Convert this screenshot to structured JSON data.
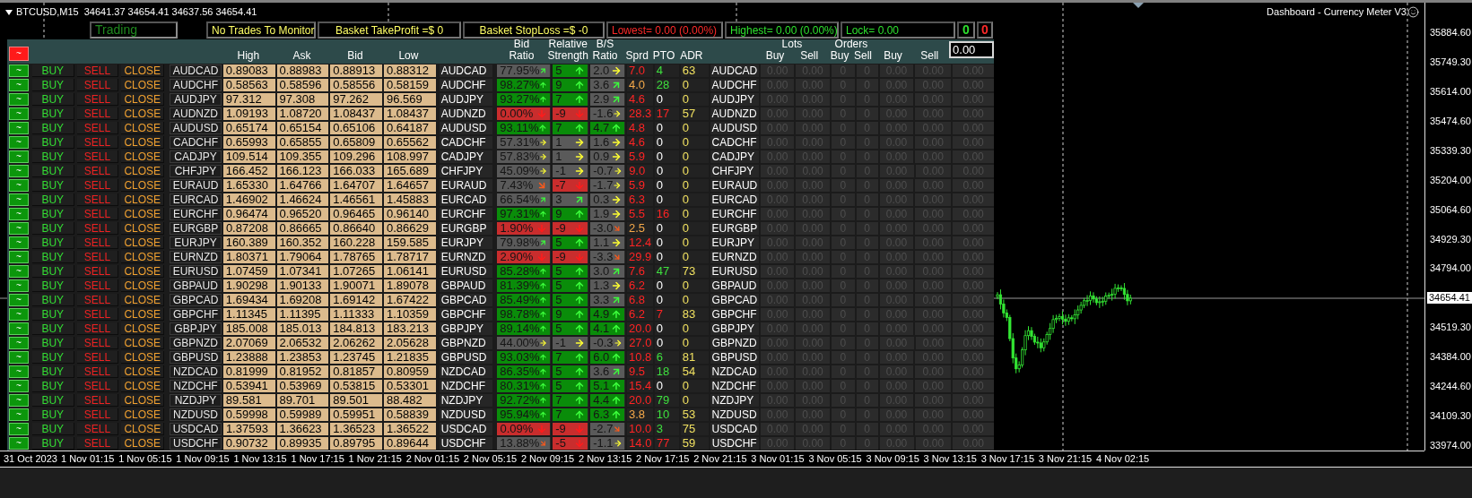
{
  "title": {
    "symbol": "BTCUSD,M15",
    "quotes": "34641.37 34654.41 34637.56 34654.41"
  },
  "indicator": "Dashboard - Currency Meter V3",
  "status_bar": [
    {
      "text": "Trading",
      "color": "#1f8a1f"
    },
    {
      "text": "No Trades To Monitor",
      "color": "#ffff66"
    },
    {
      "text": "Basket TakeProfit =$ 0",
      "color": "#ffff66"
    },
    {
      "text": "Basket StopLoss =$ -0",
      "color": "#ffff66"
    },
    {
      "text": "Lowest= 0.00 (0.00%)",
      "color": "#ff2a2a"
    },
    {
      "text": "Highest= 0.00 (0.00%)",
      "color": "#2ee02e"
    },
    {
      "text": "Lock= 0.00",
      "color": "#2ee02e"
    },
    {
      "text": "0",
      "color": "#2ee02e"
    },
    {
      "text": "0",
      "color": "#ff2a2a"
    }
  ],
  "header": {
    "toggle": {
      "label": "~",
      "on": false
    },
    "prices": [
      "High",
      "Ask",
      "Bid",
      "Low"
    ],
    "indicators": [
      "Bid Ratio",
      "Relative Strength",
      "B/S Ratio",
      "Sprd",
      "PTO",
      "ADR"
    ],
    "lots": {
      "label": "Lots",
      "buy": "Buy",
      "sell": "Sell"
    },
    "orders": {
      "label": "Orders",
      "buy": "Buy",
      "sell": "Sell"
    },
    "other": {
      "buy": "Buy",
      "sell": "Sell"
    },
    "lot_input": "0.00"
  },
  "rows": [
    {
      "toggle": {
        "label": "~",
        "on": true
      },
      "actions": [
        "BUY",
        "SELL",
        "CLOSE"
      ],
      "symbol": "AUDCAD",
      "prices": [
        "0.89083",
        "0.88983",
        "0.88913",
        "0.88312"
      ],
      "symbol_2": "AUDCAD",
      "bid_ratio": {
        "value": "77.95%",
        "color": "#5a5a5a",
        "arrow": {
          "kind": "up-right"
        }
      },
      "strength": {
        "value": "5",
        "color": "#0a8c0a",
        "arrow": {
          "kind": "up"
        }
      },
      "bs_ratio": {
        "value": "2.0",
        "color": "#5a5a5a",
        "arrow": {
          "kind": "right"
        }
      },
      "sprd": {
        "value": "7.0",
        "color": "#ff2424"
      },
      "pto": {
        "value": "4",
        "color": "#3ee03e"
      },
      "adr": "63",
      "symbol_3": "AUDCAD",
      "positions": [
        "0.00",
        "0.00",
        "0",
        "0",
        "0.00",
        "0.00",
        "0.00"
      ]
    },
    {
      "toggle": {
        "label": "~",
        "on": true
      },
      "actions": [
        "BUY",
        "SELL",
        "CLOSE"
      ],
      "symbol": "AUDCHF",
      "prices": [
        "0.58563",
        "0.58596",
        "0.58556",
        "0.58159"
      ],
      "symbol_2": "AUDCHF",
      "bid_ratio": {
        "value": "98.27%",
        "color": "#0a8c0a",
        "arrow": {
          "kind": "up"
        }
      },
      "strength": {
        "value": "9",
        "color": "#0a8c0a",
        "arrow": {
          "kind": "up"
        }
      },
      "bs_ratio": {
        "value": "3.6",
        "color": "#5a5a5a",
        "arrow": {
          "kind": "up-right"
        }
      },
      "sprd": {
        "value": "4.0",
        "color": "#f5a94a"
      },
      "pto": {
        "value": "28",
        "color": "#3ee03e"
      },
      "adr": "0",
      "symbol_3": "AUDCHF",
      "positions": [
        "0.00",
        "0.00",
        "0",
        "0",
        "0.00",
        "0.00",
        "0.00"
      ]
    },
    {
      "toggle": {
        "label": "~",
        "on": true
      },
      "actions": [
        "BUY",
        "SELL",
        "CLOSE"
      ],
      "symbol": "AUDJPY",
      "prices": [
        "97.312",
        "97.308",
        "97.262",
        "96.569"
      ],
      "symbol_2": "AUDJPY",
      "bid_ratio": {
        "value": "93.27%",
        "color": "#0a8c0a",
        "arrow": {
          "kind": "up"
        }
      },
      "strength": {
        "value": "7",
        "color": "#0a8c0a",
        "arrow": {
          "kind": "up"
        }
      },
      "bs_ratio": {
        "value": "2.9",
        "color": "#5a5a5a",
        "arrow": {
          "kind": "up-right"
        }
      },
      "sprd": {
        "value": "4.6",
        "color": "#ff2424"
      },
      "pto": {
        "value": "0"
      },
      "adr": "0",
      "symbol_3": "AUDJPY",
      "positions": [
        "0.00",
        "0.00",
        "0",
        "0",
        "0.00",
        "0.00",
        "0.00"
      ]
    },
    {
      "toggle": {
        "label": "~",
        "on": true
      },
      "actions": [
        "BUY",
        "SELL",
        "CLOSE"
      ],
      "symbol": "AUDNZD",
      "prices": [
        "1.09193",
        "1.08720",
        "1.08437",
        "1.08437"
      ],
      "symbol_2": "AUDNZD",
      "bid_ratio": {
        "value": "0.00%",
        "color": "#c92d2d",
        "arrow": {
          "kind": "down"
        }
      },
      "strength": {
        "value": "-9",
        "color": "#c92d2d",
        "arrow": {
          "kind": "down"
        }
      },
      "bs_ratio": {
        "value": "-1.6",
        "color": "#5a5a5a",
        "arrow": {
          "kind": "right"
        }
      },
      "sprd": {
        "value": "28.3",
        "color": "#ff2424"
      },
      "pto": {
        "value": "17",
        "color": "#ff2424"
      },
      "adr": "57",
      "symbol_3": "AUDNZD",
      "positions": [
        "0.00",
        "0.00",
        "0",
        "0",
        "0.00",
        "0.00",
        "0.00"
      ]
    },
    {
      "toggle": {
        "label": "~",
        "on": true
      },
      "actions": [
        "BUY",
        "SELL",
        "CLOSE"
      ],
      "symbol": "AUDUSD",
      "prices": [
        "0.65174",
        "0.65154",
        "0.65106",
        "0.64187"
      ],
      "symbol_2": "AUDUSD",
      "bid_ratio": {
        "value": "93.11%",
        "color": "#0a8c0a",
        "arrow": {
          "kind": "up"
        }
      },
      "strength": {
        "value": "7",
        "color": "#0a8c0a",
        "arrow": {
          "kind": "up"
        }
      },
      "bs_ratio": {
        "value": "4.7",
        "color": "#0a8c0a",
        "arrow": {
          "kind": "up"
        }
      },
      "sprd": {
        "value": "4.8",
        "color": "#ff2424"
      },
      "pto": {
        "value": "0"
      },
      "adr": "0",
      "symbol_3": "AUDUSD",
      "positions": [
        "0.00",
        "0.00",
        "0",
        "0",
        "0.00",
        "0.00",
        "0.00"
      ]
    },
    {
      "toggle": {
        "label": "~",
        "on": true
      },
      "actions": [
        "BUY",
        "SELL",
        "CLOSE"
      ],
      "symbol": "CADCHF",
      "prices": [
        "0.65993",
        "0.65855",
        "0.65809",
        "0.65562"
      ],
      "symbol_2": "CADCHF",
      "bid_ratio": {
        "value": "57.31%",
        "color": "#5a5a5a",
        "arrow": {
          "kind": "right"
        }
      },
      "strength": {
        "value": "1",
        "color": "#5a5a5a",
        "arrow": {
          "kind": "right"
        }
      },
      "bs_ratio": {
        "value": "1.6",
        "color": "#5a5a5a",
        "arrow": {
          "kind": "right"
        }
      },
      "sprd": {
        "value": "4.6",
        "color": "#ff2424"
      },
      "pto": {
        "value": "0"
      },
      "adr": "0",
      "symbol_3": "CADCHF",
      "positions": [
        "0.00",
        "0.00",
        "0",
        "0",
        "0.00",
        "0.00",
        "0.00"
      ]
    },
    {
      "toggle": {
        "label": "~",
        "on": true
      },
      "actions": [
        "BUY",
        "SELL",
        "CLOSE"
      ],
      "symbol": "CADJPY",
      "prices": [
        "109.514",
        "109.355",
        "109.296",
        "108.997"
      ],
      "symbol_2": "CADJPY",
      "bid_ratio": {
        "value": "57.83%",
        "color": "#5a5a5a",
        "arrow": {
          "kind": "right"
        }
      },
      "strength": {
        "value": "1",
        "color": "#5a5a5a",
        "arrow": {
          "kind": "right"
        }
      },
      "bs_ratio": {
        "value": "0.9",
        "color": "#5a5a5a",
        "arrow": {
          "kind": "right"
        }
      },
      "sprd": {
        "value": "5.9",
        "color": "#ff2424"
      },
      "pto": {
        "value": "0"
      },
      "adr": "0",
      "symbol_3": "CADJPY",
      "positions": [
        "0.00",
        "0.00",
        "0",
        "0",
        "0.00",
        "0.00",
        "0.00"
      ]
    },
    {
      "toggle": {
        "label": "~",
        "on": true
      },
      "actions": [
        "BUY",
        "SELL",
        "CLOSE"
      ],
      "symbol": "CHFJPY",
      "prices": [
        "166.452",
        "166.123",
        "166.033",
        "165.689"
      ],
      "symbol_2": "CHFJPY",
      "bid_ratio": {
        "value": "45.09%",
        "color": "#5a5a5a",
        "arrow": {
          "kind": "right"
        }
      },
      "strength": {
        "value": "-1",
        "color": "#5a5a5a",
        "arrow": {
          "kind": "right"
        }
      },
      "bs_ratio": {
        "value": "-0.7",
        "color": "#5a5a5a",
        "arrow": {
          "kind": "right"
        }
      },
      "sprd": {
        "value": "9.0",
        "color": "#ff2424"
      },
      "pto": {
        "value": "0"
      },
      "adr": "0",
      "symbol_3": "CHFJPY",
      "positions": [
        "0.00",
        "0.00",
        "0",
        "0",
        "0.00",
        "0.00",
        "0.00"
      ]
    },
    {
      "toggle": {
        "label": "~",
        "on": true
      },
      "actions": [
        "BUY",
        "SELL",
        "CLOSE"
      ],
      "symbol": "EURAUD",
      "prices": [
        "1.65330",
        "1.64766",
        "1.64707",
        "1.64657"
      ],
      "symbol_2": "EURAUD",
      "bid_ratio": {
        "value": "7.43%",
        "color": "#5a5a5a",
        "arrow": {
          "kind": "down-right"
        }
      },
      "strength": {
        "value": "-7",
        "color": "#c92d2d",
        "arrow": {
          "kind": "down"
        }
      },
      "bs_ratio": {
        "value": "-1.7",
        "color": "#5a5a5a",
        "arrow": {
          "kind": "right"
        }
      },
      "sprd": {
        "value": "5.9",
        "color": "#ff2424"
      },
      "pto": {
        "value": "0"
      },
      "adr": "0",
      "symbol_3": "EURAUD",
      "positions": [
        "0.00",
        "0.00",
        "0",
        "0",
        "0.00",
        "0.00",
        "0.00"
      ]
    },
    {
      "toggle": {
        "label": "~",
        "on": true
      },
      "actions": [
        "BUY",
        "SELL",
        "CLOSE"
      ],
      "symbol": "EURCAD",
      "prices": [
        "1.46902",
        "1.46624",
        "1.46561",
        "1.45883"
      ],
      "symbol_2": "EURCAD",
      "bid_ratio": {
        "value": "66.54%",
        "color": "#5a5a5a",
        "arrow": {
          "kind": "up-right"
        }
      },
      "strength": {
        "value": "3",
        "color": "#5a5a5a",
        "arrow": {
          "kind": "up-right"
        }
      },
      "bs_ratio": {
        "value": "0.3",
        "color": "#5a5a5a",
        "arrow": {
          "kind": "right"
        }
      },
      "sprd": {
        "value": "6.3",
        "color": "#ff2424"
      },
      "pto": {
        "value": "0"
      },
      "adr": "0",
      "symbol_3": "EURCAD",
      "positions": [
        "0.00",
        "0.00",
        "0",
        "0",
        "0.00",
        "0.00",
        "0.00"
      ]
    },
    {
      "toggle": {
        "label": "~",
        "on": true
      },
      "actions": [
        "BUY",
        "SELL",
        "CLOSE"
      ],
      "symbol": "EURCHF",
      "prices": [
        "0.96474",
        "0.96520",
        "0.96465",
        "0.96140"
      ],
      "symbol_2": "EURCHF",
      "bid_ratio": {
        "value": "97.31%",
        "color": "#0a8c0a",
        "arrow": {
          "kind": "up"
        }
      },
      "strength": {
        "value": "9",
        "color": "#0a8c0a",
        "arrow": {
          "kind": "up"
        }
      },
      "bs_ratio": {
        "value": "1.9",
        "color": "#5a5a5a",
        "arrow": {
          "kind": "right"
        }
      },
      "sprd": {
        "value": "5.5",
        "color": "#ff2424"
      },
      "pto": {
        "value": "16",
        "color": "#ff2424"
      },
      "adr": "0",
      "symbol_3": "EURCHF",
      "positions": [
        "0.00",
        "0.00",
        "0",
        "0",
        "0.00",
        "0.00",
        "0.00"
      ]
    },
    {
      "toggle": {
        "label": "~",
        "on": true
      },
      "actions": [
        "BUY",
        "SELL",
        "CLOSE"
      ],
      "symbol": "EURGBP",
      "prices": [
        "0.87208",
        "0.86665",
        "0.86640",
        "0.86629"
      ],
      "symbol_2": "EURGBP",
      "bid_ratio": {
        "value": "1.90%",
        "color": "#c92d2d",
        "arrow": {
          "kind": "down"
        }
      },
      "strength": {
        "value": "-9",
        "color": "#c92d2d",
        "arrow": {
          "kind": "down"
        }
      },
      "bs_ratio": {
        "value": "-3.0",
        "color": "#5a5a5a",
        "arrow": {
          "kind": "down-right"
        }
      },
      "sprd": {
        "value": "2.5",
        "color": "#f5a94a"
      },
      "pto": {
        "value": "0"
      },
      "adr": "0",
      "symbol_3": "EURGBP",
      "positions": [
        "0.00",
        "0.00",
        "0",
        "0",
        "0.00",
        "0.00",
        "0.00"
      ]
    },
    {
      "toggle": {
        "label": "~",
        "on": true
      },
      "actions": [
        "BUY",
        "SELL",
        "CLOSE"
      ],
      "symbol": "EURJPY",
      "prices": [
        "160.389",
        "160.352",
        "160.228",
        "159.585"
      ],
      "symbol_2": "EURJPY",
      "bid_ratio": {
        "value": "79.98%",
        "color": "#5a5a5a",
        "arrow": {
          "kind": "up-right"
        }
      },
      "strength": {
        "value": "5",
        "color": "#0a8c0a",
        "arrow": {
          "kind": "up"
        }
      },
      "bs_ratio": {
        "value": "1.1",
        "color": "#5a5a5a",
        "arrow": {
          "kind": "right"
        }
      },
      "sprd": {
        "value": "12.4",
        "color": "#ff2424"
      },
      "pto": {
        "value": "0"
      },
      "adr": "0",
      "symbol_3": "EURJPY",
      "positions": [
        "0.00",
        "0.00",
        "0",
        "0",
        "0.00",
        "0.00",
        "0.00"
      ]
    },
    {
      "toggle": {
        "label": "~",
        "on": true
      },
      "actions": [
        "BUY",
        "SELL",
        "CLOSE"
      ],
      "symbol": "EURNZD",
      "prices": [
        "1.80371",
        "1.79064",
        "1.78765",
        "1.78717"
      ],
      "symbol_2": "EURNZD",
      "bid_ratio": {
        "value": "2.90%",
        "color": "#c92d2d",
        "arrow": {
          "kind": "down"
        }
      },
      "strength": {
        "value": "-9",
        "color": "#c92d2d",
        "arrow": {
          "kind": "down"
        }
      },
      "bs_ratio": {
        "value": "-3.3",
        "color": "#5a5a5a",
        "arrow": {
          "kind": "down-right"
        }
      },
      "sprd": {
        "value": "29.9",
        "color": "#ff2424"
      },
      "pto": {
        "value": "0"
      },
      "adr": "0",
      "symbol_3": "EURNZD",
      "positions": [
        "0.00",
        "0.00",
        "0",
        "0",
        "0.00",
        "0.00",
        "0.00"
      ]
    },
    {
      "toggle": {
        "label": "~",
        "on": true
      },
      "actions": [
        "BUY",
        "SELL",
        "CLOSE"
      ],
      "symbol": "EURUSD",
      "prices": [
        "1.07459",
        "1.07341",
        "1.07265",
        "1.06141"
      ],
      "symbol_2": "EURUSD",
      "bid_ratio": {
        "value": "85.28%",
        "color": "#0a8c0a",
        "arrow": {
          "kind": "up"
        }
      },
      "strength": {
        "value": "5",
        "color": "#0a8c0a",
        "arrow": {
          "kind": "up"
        }
      },
      "bs_ratio": {
        "value": "3.0",
        "color": "#5a5a5a",
        "arrow": {
          "kind": "up-right"
        }
      },
      "sprd": {
        "value": "7.6",
        "color": "#ff2424"
      },
      "pto": {
        "value": "47",
        "color": "#3ee03e"
      },
      "adr": "73",
      "symbol_3": "EURUSD",
      "positions": [
        "0.00",
        "0.00",
        "0",
        "0",
        "0.00",
        "0.00",
        "0.00"
      ]
    },
    {
      "toggle": {
        "label": "~",
        "on": true
      },
      "actions": [
        "BUY",
        "SELL",
        "CLOSE"
      ],
      "symbol": "GBPAUD",
      "prices": [
        "1.90298",
        "1.90133",
        "1.90071",
        "1.89078"
      ],
      "symbol_2": "GBPAUD",
      "bid_ratio": {
        "value": "81.39%",
        "color": "#0a8c0a",
        "arrow": {
          "kind": "up"
        }
      },
      "strength": {
        "value": "5",
        "color": "#0a8c0a",
        "arrow": {
          "kind": "up"
        }
      },
      "bs_ratio": {
        "value": "1.3",
        "color": "#5a5a5a",
        "arrow": {
          "kind": "right"
        }
      },
      "sprd": {
        "value": "6.2",
        "color": "#ff2424"
      },
      "pto": {
        "value": "0"
      },
      "adr": "0",
      "symbol_3": "GBPAUD",
      "positions": [
        "0.00",
        "0.00",
        "0",
        "0",
        "0.00",
        "0.00",
        "0.00"
      ]
    },
    {
      "toggle": {
        "label": "~",
        "on": true
      },
      "actions": [
        "BUY",
        "SELL",
        "CLOSE"
      ],
      "symbol": "GBPCAD",
      "prices": [
        "1.69434",
        "1.69208",
        "1.69142",
        "1.67422"
      ],
      "symbol_2": "GBPCAD",
      "bid_ratio": {
        "value": "85.49%",
        "color": "#0a8c0a",
        "arrow": {
          "kind": "up"
        }
      },
      "strength": {
        "value": "5",
        "color": "#0a8c0a",
        "arrow": {
          "kind": "up"
        }
      },
      "bs_ratio": {
        "value": "3.3",
        "color": "#5a5a5a",
        "arrow": {
          "kind": "up-right"
        }
      },
      "sprd": {
        "value": "6.8",
        "color": "#ff2424"
      },
      "pto": {
        "value": "0"
      },
      "adr": "0",
      "symbol_3": "GBPCAD",
      "positions": [
        "0.00",
        "0.00",
        "0",
        "0",
        "0.00",
        "0.00",
        "0.00"
      ]
    },
    {
      "toggle": {
        "label": "~",
        "on": true
      },
      "actions": [
        "BUY",
        "SELL",
        "CLOSE"
      ],
      "symbol": "GBPCHF",
      "prices": [
        "1.11345",
        "1.11395",
        "1.11333",
        "1.10359"
      ],
      "symbol_2": "GBPCHF",
      "bid_ratio": {
        "value": "98.78%",
        "color": "#0a8c0a",
        "arrow": {
          "kind": "up"
        }
      },
      "strength": {
        "value": "9",
        "color": "#0a8c0a",
        "arrow": {
          "kind": "up"
        }
      },
      "bs_ratio": {
        "value": "4.9",
        "color": "#0a8c0a",
        "arrow": {
          "kind": "up"
        }
      },
      "sprd": {
        "value": "6.2",
        "color": "#ff2424"
      },
      "pto": {
        "value": "7",
        "color": "#ff2424"
      },
      "adr": "83",
      "symbol_3": "GBPCHF",
      "positions": [
        "0.00",
        "0.00",
        "0",
        "0",
        "0.00",
        "0.00",
        "0.00"
      ]
    },
    {
      "toggle": {
        "label": "~",
        "on": true
      },
      "actions": [
        "BUY",
        "SELL",
        "CLOSE"
      ],
      "symbol": "GBPJPY",
      "prices": [
        "185.008",
        "185.013",
        "184.813",
        "183.213"
      ],
      "symbol_2": "GBPJPY",
      "bid_ratio": {
        "value": "89.14%",
        "color": "#0a8c0a",
        "arrow": {
          "kind": "up"
        }
      },
      "strength": {
        "value": "5",
        "color": "#0a8c0a",
        "arrow": {
          "kind": "up"
        }
      },
      "bs_ratio": {
        "value": "4.1",
        "color": "#0a8c0a",
        "arrow": {
          "kind": "up"
        }
      },
      "sprd": {
        "value": "20.0",
        "color": "#ff2424"
      },
      "pto": {
        "value": "0"
      },
      "adr": "0",
      "symbol_3": "GBPJPY",
      "positions": [
        "0.00",
        "0.00",
        "0",
        "0",
        "0.00",
        "0.00",
        "0.00"
      ]
    },
    {
      "toggle": {
        "label": "~",
        "on": true
      },
      "actions": [
        "BUY",
        "SELL",
        "CLOSE"
      ],
      "symbol": "GBPNZD",
      "prices": [
        "2.07069",
        "2.06532",
        "2.06262",
        "2.05628"
      ],
      "symbol_2": "GBPNZD",
      "bid_ratio": {
        "value": "44.00%",
        "color": "#5a5a5a",
        "arrow": {
          "kind": "right"
        }
      },
      "strength": {
        "value": "-1",
        "color": "#5a5a5a",
        "arrow": {
          "kind": "right"
        }
      },
      "bs_ratio": {
        "value": "-0.3",
        "color": "#5a5a5a",
        "arrow": {
          "kind": "right"
        }
      },
      "sprd": {
        "value": "27.0",
        "color": "#ff2424"
      },
      "pto": {
        "value": "0"
      },
      "adr": "0",
      "symbol_3": "GBPNZD",
      "positions": [
        "0.00",
        "0.00",
        "0",
        "0",
        "0.00",
        "0.00",
        "0.00"
      ]
    },
    {
      "toggle": {
        "label": "~",
        "on": true
      },
      "actions": [
        "BUY",
        "SELL",
        "CLOSE"
      ],
      "symbol": "GBPUSD",
      "prices": [
        "1.23888",
        "1.23853",
        "1.23745",
        "1.21835"
      ],
      "symbol_2": "GBPUSD",
      "bid_ratio": {
        "value": "93.03%",
        "color": "#0a8c0a",
        "arrow": {
          "kind": "up"
        }
      },
      "strength": {
        "value": "7",
        "color": "#0a8c0a",
        "arrow": {
          "kind": "up"
        }
      },
      "bs_ratio": {
        "value": "6.0",
        "color": "#0a8c0a",
        "arrow": {
          "kind": "up"
        }
      },
      "sprd": {
        "value": "10.8",
        "color": "#ff2424"
      },
      "pto": {
        "value": "6",
        "color": "#3ee03e"
      },
      "adr": "81",
      "symbol_3": "GBPUSD",
      "positions": [
        "0.00",
        "0.00",
        "0",
        "0",
        "0.00",
        "0.00",
        "0.00"
      ]
    },
    {
      "toggle": {
        "label": "~",
        "on": true
      },
      "actions": [
        "BUY",
        "SELL",
        "CLOSE"
      ],
      "symbol": "NZDCAD",
      "prices": [
        "0.81999",
        "0.81952",
        "0.81857",
        "0.80959"
      ],
      "symbol_2": "NZDCAD",
      "bid_ratio": {
        "value": "86.35%",
        "color": "#0a8c0a",
        "arrow": {
          "kind": "up"
        }
      },
      "strength": {
        "value": "5",
        "color": "#0a8c0a",
        "arrow": {
          "kind": "up"
        }
      },
      "bs_ratio": {
        "value": "3.6",
        "color": "#5a5a5a",
        "arrow": {
          "kind": "up-right"
        }
      },
      "sprd": {
        "value": "9.5",
        "color": "#ff2424"
      },
      "pto": {
        "value": "18",
        "color": "#3ee03e"
      },
      "adr": "54",
      "symbol_3": "NZDCAD",
      "positions": [
        "0.00",
        "0.00",
        "0",
        "0",
        "0.00",
        "0.00",
        "0.00"
      ]
    },
    {
      "toggle": {
        "label": "~",
        "on": true
      },
      "actions": [
        "BUY",
        "SELL",
        "CLOSE"
      ],
      "symbol": "NZDCHF",
      "prices": [
        "0.53941",
        "0.53969",
        "0.53815",
        "0.53301"
      ],
      "symbol_2": "NZDCHF",
      "bid_ratio": {
        "value": "80.31%",
        "color": "#0a8c0a",
        "arrow": {
          "kind": "up"
        }
      },
      "strength": {
        "value": "5",
        "color": "#0a8c0a",
        "arrow": {
          "kind": "up"
        }
      },
      "bs_ratio": {
        "value": "5.1",
        "color": "#0a8c0a",
        "arrow": {
          "kind": "up"
        }
      },
      "sprd": {
        "value": "15.4",
        "color": "#ff2424"
      },
      "pto": {
        "value": "0"
      },
      "adr": "0",
      "symbol_3": "NZDCHF",
      "positions": [
        "0.00",
        "0.00",
        "0",
        "0",
        "0.00",
        "0.00",
        "0.00"
      ]
    },
    {
      "toggle": {
        "label": "~",
        "on": true
      },
      "actions": [
        "BUY",
        "SELL",
        "CLOSE"
      ],
      "symbol": "NZDJPY",
      "prices": [
        "89.581",
        "89.701",
        "89.501",
        "88.482"
      ],
      "symbol_2": "NZDJPY",
      "bid_ratio": {
        "value": "92.72%",
        "color": "#0a8c0a",
        "arrow": {
          "kind": "up"
        }
      },
      "strength": {
        "value": "7",
        "color": "#0a8c0a",
        "arrow": {
          "kind": "up"
        }
      },
      "bs_ratio": {
        "value": "4.4",
        "color": "#0a8c0a",
        "arrow": {
          "kind": "up"
        }
      },
      "sprd": {
        "value": "20.0",
        "color": "#ff2424"
      },
      "pto": {
        "value": "79",
        "color": "#3ee03e"
      },
      "adr": "0",
      "symbol_3": "NZDJPY",
      "positions": [
        "0.00",
        "0.00",
        "0",
        "0",
        "0.00",
        "0.00",
        "0.00"
      ]
    },
    {
      "toggle": {
        "label": "~",
        "on": true
      },
      "actions": [
        "BUY",
        "SELL",
        "CLOSE"
      ],
      "symbol": "NZDUSD",
      "prices": [
        "0.59998",
        "0.59989",
        "0.59951",
        "0.58839"
      ],
      "symbol_2": "NZDUSD",
      "bid_ratio": {
        "value": "95.94%",
        "color": "#0a8c0a",
        "arrow": {
          "kind": "up"
        }
      },
      "strength": {
        "value": "7",
        "color": "#0a8c0a",
        "arrow": {
          "kind": "up"
        }
      },
      "bs_ratio": {
        "value": "6.3",
        "color": "#0a8c0a",
        "arrow": {
          "kind": "up"
        }
      },
      "sprd": {
        "value": "3.8",
        "color": "#f5a94a"
      },
      "pto": {
        "value": "10",
        "color": "#3ee03e"
      },
      "adr": "53",
      "symbol_3": "NZDUSD",
      "positions": [
        "0.00",
        "0.00",
        "0",
        "0",
        "0.00",
        "0.00",
        "0.00"
      ]
    },
    {
      "toggle": {
        "label": "~",
        "on": true
      },
      "actions": [
        "BUY",
        "SELL",
        "CLOSE"
      ],
      "symbol": "USDCAD",
      "prices": [
        "1.37593",
        "1.36623",
        "1.36523",
        "1.36522"
      ],
      "symbol_2": "USDCAD",
      "bid_ratio": {
        "value": "0.09%",
        "color": "#c92d2d",
        "arrow": {
          "kind": "down"
        }
      },
      "strength": {
        "value": "-9",
        "color": "#c92d2d",
        "arrow": {
          "kind": "down"
        }
      },
      "bs_ratio": {
        "value": "-2.7",
        "color": "#5a5a5a",
        "arrow": {
          "kind": "down-right"
        }
      },
      "sprd": {
        "value": "10.0",
        "color": "#ff2424"
      },
      "pto": {
        "value": "3",
        "color": "#3ee03e"
      },
      "adr": "75",
      "symbol_3": "USDCAD",
      "positions": [
        "0.00",
        "0.00",
        "0",
        "0",
        "0.00",
        "0.00",
        "0.00"
      ]
    },
    {
      "toggle": {
        "label": "~",
        "on": true
      },
      "actions": [
        "BUY",
        "SELL",
        "CLOSE"
      ],
      "symbol": "USDCHF",
      "prices": [
        "0.90732",
        "0.89935",
        "0.89795",
        "0.89644"
      ],
      "symbol_2": "USDCHF",
      "bid_ratio": {
        "value": "13.88%",
        "color": "#5a5a5a",
        "arrow": {
          "kind": "down-right"
        }
      },
      "strength": {
        "value": "-5",
        "color": "#c92d2d",
        "arrow": {
          "kind": "down"
        }
      },
      "bs_ratio": {
        "value": "-1.1",
        "color": "#5a5a5a",
        "arrow": {
          "kind": "right"
        }
      },
      "sprd": {
        "value": "14.0",
        "color": "#ff2424"
      },
      "pto": {
        "value": "77",
        "color": "#ff2424"
      },
      "adr": "59",
      "symbol_3": "USDCHF",
      "positions": [
        "0.00",
        "0.00",
        "0",
        "0",
        "0.00",
        "0.00",
        "0.00"
      ]
    }
  ],
  "price_axis": {
    "labels": [
      "35884.60",
      "35749.30",
      "35614.00",
      "35474.60",
      "35339.30",
      "35204.00",
      "35064.60",
      "34929.30",
      "34794.00",
      "34519.30",
      "34384.00",
      "34244.60",
      "34109.30",
      "33974.00"
    ],
    "current": "34654.41"
  },
  "time_axis": {
    "labels": [
      "31 Oct 2023",
      "1 Nov 01:15",
      "1 Nov 05:15",
      "1 Nov 09:15",
      "1 Nov 13:15",
      "1 Nov 17:15",
      "1 Nov 21:15",
      "2 Nov 01:15",
      "2 Nov 05:15",
      "2 Nov 09:15",
      "2 Nov 13:15",
      "2 Nov 17:15",
      "2 Nov 21:15",
      "3 Nov 01:15",
      "3 Nov 05:15",
      "3 Nov 09:15",
      "3 Nov 13:15",
      "3 Nov 17:15",
      "3 Nov 21:15",
      "4 Nov 02:15"
    ]
  }
}
